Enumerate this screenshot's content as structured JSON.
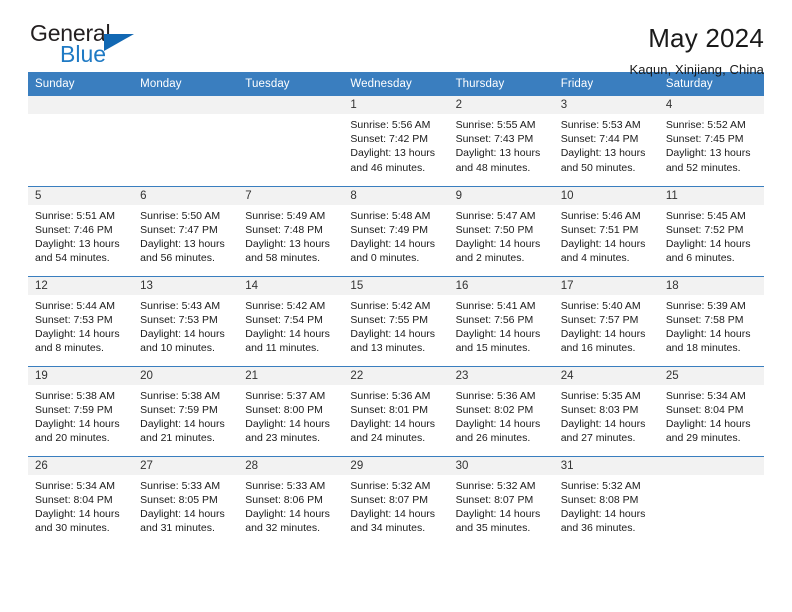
{
  "brand": {
    "name_part1": "General",
    "name_part2": "Blue",
    "triangle_color": "#1268b3",
    "blue_color": "#1f7ac4"
  },
  "header": {
    "title": "May 2024",
    "subtitle": "Kaqun, Xinjiang, China"
  },
  "theme": {
    "header_blue": "#3a7ebf",
    "daynum_band": "#f2f2f2",
    "text": "#1a1a1a"
  },
  "weekday_headers": [
    "Sunday",
    "Monday",
    "Tuesday",
    "Wednesday",
    "Thursday",
    "Friday",
    "Saturday"
  ],
  "weeks": [
    [
      {
        "day": "",
        "sunrise": "",
        "sunset": "",
        "daylight1": "",
        "daylight2": ""
      },
      {
        "day": "",
        "sunrise": "",
        "sunset": "",
        "daylight1": "",
        "daylight2": ""
      },
      {
        "day": "",
        "sunrise": "",
        "sunset": "",
        "daylight1": "",
        "daylight2": ""
      },
      {
        "day": "1",
        "sunrise": "Sunrise: 5:56 AM",
        "sunset": "Sunset: 7:42 PM",
        "daylight1": "Daylight: 13 hours",
        "daylight2": "and 46 minutes."
      },
      {
        "day": "2",
        "sunrise": "Sunrise: 5:55 AM",
        "sunset": "Sunset: 7:43 PM",
        "daylight1": "Daylight: 13 hours",
        "daylight2": "and 48 minutes."
      },
      {
        "day": "3",
        "sunrise": "Sunrise: 5:53 AM",
        "sunset": "Sunset: 7:44 PM",
        "daylight1": "Daylight: 13 hours",
        "daylight2": "and 50 minutes."
      },
      {
        "day": "4",
        "sunrise": "Sunrise: 5:52 AM",
        "sunset": "Sunset: 7:45 PM",
        "daylight1": "Daylight: 13 hours",
        "daylight2": "and 52 minutes."
      }
    ],
    [
      {
        "day": "5",
        "sunrise": "Sunrise: 5:51 AM",
        "sunset": "Sunset: 7:46 PM",
        "daylight1": "Daylight: 13 hours",
        "daylight2": "and 54 minutes."
      },
      {
        "day": "6",
        "sunrise": "Sunrise: 5:50 AM",
        "sunset": "Sunset: 7:47 PM",
        "daylight1": "Daylight: 13 hours",
        "daylight2": "and 56 minutes."
      },
      {
        "day": "7",
        "sunrise": "Sunrise: 5:49 AM",
        "sunset": "Sunset: 7:48 PM",
        "daylight1": "Daylight: 13 hours",
        "daylight2": "and 58 minutes."
      },
      {
        "day": "8",
        "sunrise": "Sunrise: 5:48 AM",
        "sunset": "Sunset: 7:49 PM",
        "daylight1": "Daylight: 14 hours",
        "daylight2": "and 0 minutes."
      },
      {
        "day": "9",
        "sunrise": "Sunrise: 5:47 AM",
        "sunset": "Sunset: 7:50 PM",
        "daylight1": "Daylight: 14 hours",
        "daylight2": "and 2 minutes."
      },
      {
        "day": "10",
        "sunrise": "Sunrise: 5:46 AM",
        "sunset": "Sunset: 7:51 PM",
        "daylight1": "Daylight: 14 hours",
        "daylight2": "and 4 minutes."
      },
      {
        "day": "11",
        "sunrise": "Sunrise: 5:45 AM",
        "sunset": "Sunset: 7:52 PM",
        "daylight1": "Daylight: 14 hours",
        "daylight2": "and 6 minutes."
      }
    ],
    [
      {
        "day": "12",
        "sunrise": "Sunrise: 5:44 AM",
        "sunset": "Sunset: 7:53 PM",
        "daylight1": "Daylight: 14 hours",
        "daylight2": "and 8 minutes."
      },
      {
        "day": "13",
        "sunrise": "Sunrise: 5:43 AM",
        "sunset": "Sunset: 7:53 PM",
        "daylight1": "Daylight: 14 hours",
        "daylight2": "and 10 minutes."
      },
      {
        "day": "14",
        "sunrise": "Sunrise: 5:42 AM",
        "sunset": "Sunset: 7:54 PM",
        "daylight1": "Daylight: 14 hours",
        "daylight2": "and 11 minutes."
      },
      {
        "day": "15",
        "sunrise": "Sunrise: 5:42 AM",
        "sunset": "Sunset: 7:55 PM",
        "daylight1": "Daylight: 14 hours",
        "daylight2": "and 13 minutes."
      },
      {
        "day": "16",
        "sunrise": "Sunrise: 5:41 AM",
        "sunset": "Sunset: 7:56 PM",
        "daylight1": "Daylight: 14 hours",
        "daylight2": "and 15 minutes."
      },
      {
        "day": "17",
        "sunrise": "Sunrise: 5:40 AM",
        "sunset": "Sunset: 7:57 PM",
        "daylight1": "Daylight: 14 hours",
        "daylight2": "and 16 minutes."
      },
      {
        "day": "18",
        "sunrise": "Sunrise: 5:39 AM",
        "sunset": "Sunset: 7:58 PM",
        "daylight1": "Daylight: 14 hours",
        "daylight2": "and 18 minutes."
      }
    ],
    [
      {
        "day": "19",
        "sunrise": "Sunrise: 5:38 AM",
        "sunset": "Sunset: 7:59 PM",
        "daylight1": "Daylight: 14 hours",
        "daylight2": "and 20 minutes."
      },
      {
        "day": "20",
        "sunrise": "Sunrise: 5:38 AM",
        "sunset": "Sunset: 7:59 PM",
        "daylight1": "Daylight: 14 hours",
        "daylight2": "and 21 minutes."
      },
      {
        "day": "21",
        "sunrise": "Sunrise: 5:37 AM",
        "sunset": "Sunset: 8:00 PM",
        "daylight1": "Daylight: 14 hours",
        "daylight2": "and 23 minutes."
      },
      {
        "day": "22",
        "sunrise": "Sunrise: 5:36 AM",
        "sunset": "Sunset: 8:01 PM",
        "daylight1": "Daylight: 14 hours",
        "daylight2": "and 24 minutes."
      },
      {
        "day": "23",
        "sunrise": "Sunrise: 5:36 AM",
        "sunset": "Sunset: 8:02 PM",
        "daylight1": "Daylight: 14 hours",
        "daylight2": "and 26 minutes."
      },
      {
        "day": "24",
        "sunrise": "Sunrise: 5:35 AM",
        "sunset": "Sunset: 8:03 PM",
        "daylight1": "Daylight: 14 hours",
        "daylight2": "and 27 minutes."
      },
      {
        "day": "25",
        "sunrise": "Sunrise: 5:34 AM",
        "sunset": "Sunset: 8:04 PM",
        "daylight1": "Daylight: 14 hours",
        "daylight2": "and 29 minutes."
      }
    ],
    [
      {
        "day": "26",
        "sunrise": "Sunrise: 5:34 AM",
        "sunset": "Sunset: 8:04 PM",
        "daylight1": "Daylight: 14 hours",
        "daylight2": "and 30 minutes."
      },
      {
        "day": "27",
        "sunrise": "Sunrise: 5:33 AM",
        "sunset": "Sunset: 8:05 PM",
        "daylight1": "Daylight: 14 hours",
        "daylight2": "and 31 minutes."
      },
      {
        "day": "28",
        "sunrise": "Sunrise: 5:33 AM",
        "sunset": "Sunset: 8:06 PM",
        "daylight1": "Daylight: 14 hours",
        "daylight2": "and 32 minutes."
      },
      {
        "day": "29",
        "sunrise": "Sunrise: 5:32 AM",
        "sunset": "Sunset: 8:07 PM",
        "daylight1": "Daylight: 14 hours",
        "daylight2": "and 34 minutes."
      },
      {
        "day": "30",
        "sunrise": "Sunrise: 5:32 AM",
        "sunset": "Sunset: 8:07 PM",
        "daylight1": "Daylight: 14 hours",
        "daylight2": "and 35 minutes."
      },
      {
        "day": "31",
        "sunrise": "Sunrise: 5:32 AM",
        "sunset": "Sunset: 8:08 PM",
        "daylight1": "Daylight: 14 hours",
        "daylight2": "and 36 minutes."
      },
      {
        "day": "",
        "sunrise": "",
        "sunset": "",
        "daylight1": "",
        "daylight2": ""
      }
    ]
  ]
}
